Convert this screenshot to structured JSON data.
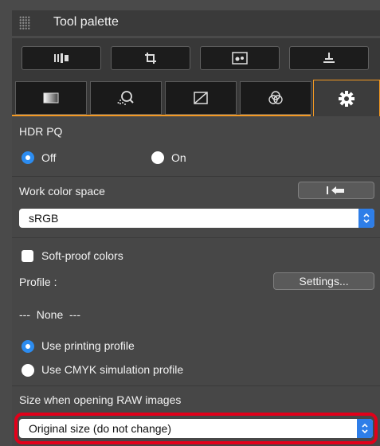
{
  "window": {
    "title": "Tool palette"
  },
  "toolbar": {
    "buttons": [
      {
        "icon": "adjustment-bars-icon"
      },
      {
        "icon": "crop-icon"
      },
      {
        "icon": "image-mask-icon"
      },
      {
        "icon": "stamp-icon"
      }
    ]
  },
  "tabs": [
    {
      "icon": "gradient-square-icon",
      "active": false
    },
    {
      "icon": "magnifier-grid-icon",
      "active": false
    },
    {
      "icon": "tone-curve-icon",
      "active": false
    },
    {
      "icon": "color-circles-icon",
      "active": false
    },
    {
      "icon": "gear-icon",
      "active": true
    }
  ],
  "hdr": {
    "label": "HDR PQ",
    "options": [
      {
        "label": "Off",
        "selected": true
      },
      {
        "label": "On",
        "selected": false
      }
    ]
  },
  "work_color_space": {
    "label": "Work color space",
    "reset_icon": "reset-arrow-icon",
    "value": "sRGB"
  },
  "soft_proof": {
    "label": "Soft-proof colors",
    "checked": false
  },
  "profile": {
    "label": "Profile :",
    "settings_label": "Settings...",
    "value": "---  None  ---"
  },
  "printing_options": [
    {
      "label": "Use printing profile",
      "selected": true
    },
    {
      "label": "Use CMYK simulation profile",
      "selected": false
    }
  ],
  "raw_size": {
    "label": "Size when opening RAW images",
    "value": "Original size (do not change)"
  },
  "colors": {
    "accent": "#f59a23",
    "highlight": "#e2001a",
    "select_blue": "#2e7ee8"
  }
}
